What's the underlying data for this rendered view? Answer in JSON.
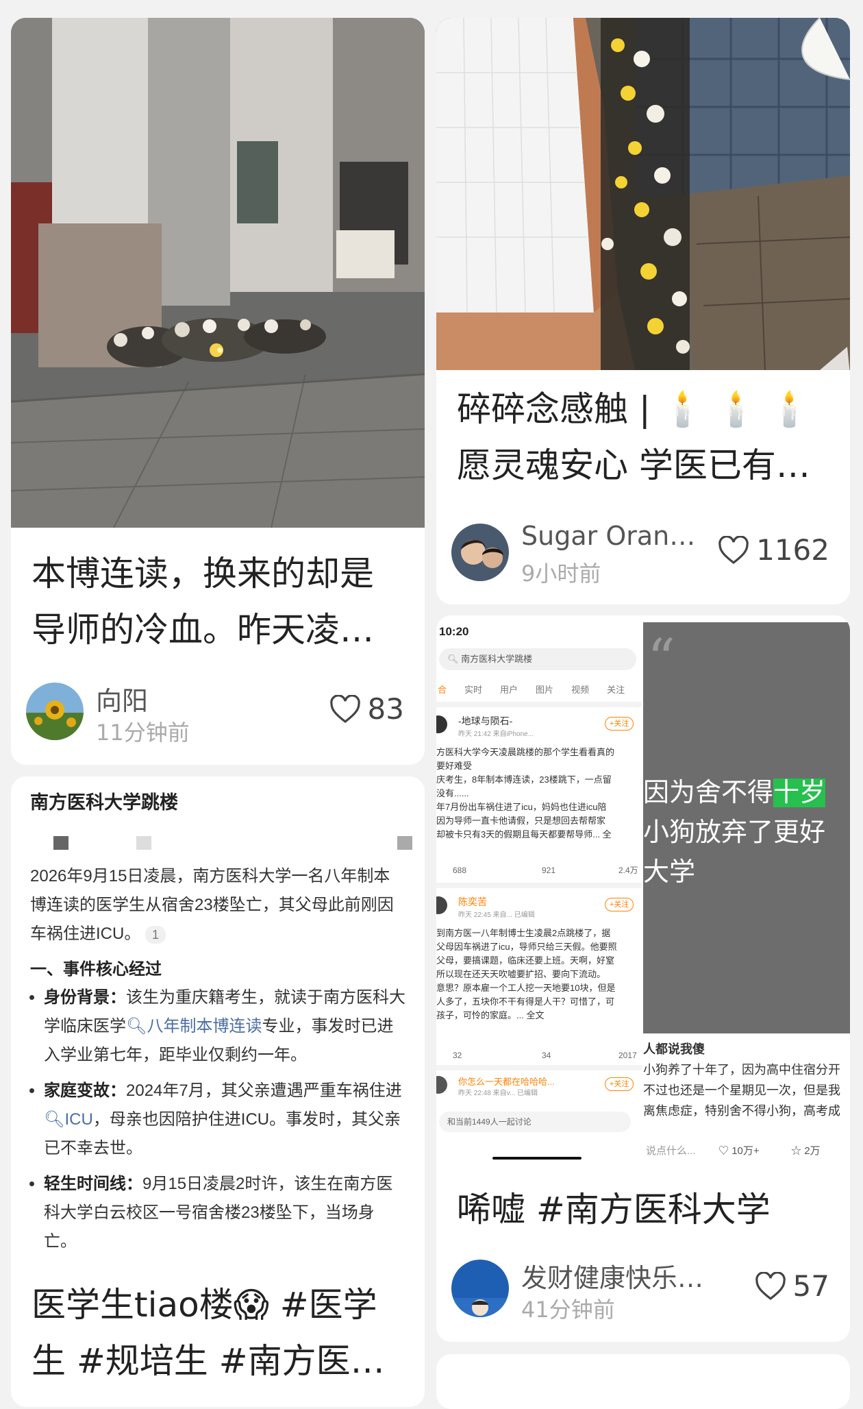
{
  "cards": [
    {
      "title_line1": "本博连读，换来的却是",
      "title_line2": "导师的冷血。昨天凌…",
      "author": "向阳",
      "time": "11分钟前",
      "likes": "83"
    },
    {
      "title_line1": "碎碎念感触 | 🕯️ 🕯️ 🕯️",
      "title_line2": "愿灵魂安心 学医已有…",
      "author": "Sugar Oran…",
      "time": "9小时前",
      "likes": "1162"
    },
    {
      "wiki_title": "南方医科大学跳楼",
      "wiki_intro": "2026年9月15日凌晨，南方医科大学一名八年制本博连读的医学生从宿舍23楼坠亡，其父母此前刚因车祸住进ICU。",
      "wiki_ref": "1",
      "wiki_section": "一、事件核心经过",
      "bullets": [
        {
          "label": "身份背景：",
          "pre": "该生为重庆籍考生，就读于南方医科大学临床医学",
          "link": "八年制本博连读",
          "post": "专业，事发时已进入学业第七年，距毕业仅剩约一年。"
        },
        {
          "label": "家庭变故：",
          "pre": "2024年7月，其父亲遭遇严重车祸住进",
          "link": "ICU",
          "post": "，母亲也因陪护住进ICU。事发时，其父亲已不幸去世。"
        },
        {
          "label": "轻生时间线：",
          "pre": "9月15日凌晨2时许，该生在南方医科大学白云校区一号宿舍楼23楼坠下，当场身亡。",
          "link": "",
          "post": ""
        }
      ],
      "title_line1": "医学生tiao楼😱 #医学",
      "title_line2": "生  #规培生  #南方医…"
    },
    {
      "screenshot": {
        "status_time": "10:20",
        "search_text": "南方医科大学跳楼",
        "tabs": [
          "合",
          "实时",
          "用户",
          "图片",
          "视频",
          "关注"
        ],
        "posts": [
          {
            "name": "-地球与陨石-",
            "sub": "昨天 21:42  来自iPhone...",
            "follow": "+关注",
            "lines": [
              "方医科大学今天凌晨跳楼的那个学生看看真的",
              "要好难受",
              "庆考生，8年制本博连读，23楼跳下，一点留",
              "没有......",
              "年7月份出车祸住进了icu，妈妈也住进icu陪",
              "因为导师一直卡他请假，只是想回去帮帮家",
              "却被卡只有3天的假期且每天都要帮导师... 全"
            ],
            "stats": [
              "688",
              "921",
              "2.4万"
            ]
          },
          {
            "name": "陈奕苦",
            "sub": "昨天 22:45  来自... 已编辑",
            "follow": "+关注",
            "lines": [
              "到南方医一八年制博士生凌晨2点跳楼了，据",
              "父母因车祸进了icu，导师只给三天假。他要照",
              "父母，要搞课题，临床还要上班。天啊，好窒",
              "所以现在还天天吹嘘要扩招、要向下流动。",
              "意思？原本雇一个工人挖一天地要10块，但是",
              "人多了，五块你不干有得是人干？可惜了，可",
              "孩子，可怜的家庭。... 全文"
            ],
            "stats": [
              "32",
              "34",
              "2017"
            ]
          },
          {
            "name": "你怎么一天都在哈哈哈...",
            "sub": "昨天 22:48  来自v... 已编辑",
            "follow": "+关注",
            "lines": [],
            "stats": []
          }
        ],
        "discuss": "和当前1449人一起讨论",
        "quote_text_1": "因为舍不得",
        "quote_hl": "十岁",
        "quote_text_2": "小狗放弃了更好",
        "quote_text_3": "大学",
        "reply_title": "人都说我傻",
        "reply_lines": [
          "小狗养了十年了，因为高中住宿分开",
          "不过也还是一个星期见一次，但是我",
          "离焦虑症，特别舍不得小狗，高考成"
        ],
        "comment_placeholder": "说点什么...",
        "like_count": "10万+",
        "share_count": "2万"
      },
      "title_line1": "唏嘘 #南方医科大学",
      "author": "发财健康快乐…",
      "time": "41分钟前",
      "likes": "57"
    }
  ],
  "colors": {
    "accent_green": "#25c04d",
    "link_blue": "#4a6fa5",
    "weibo_orange": "#ff8200"
  }
}
